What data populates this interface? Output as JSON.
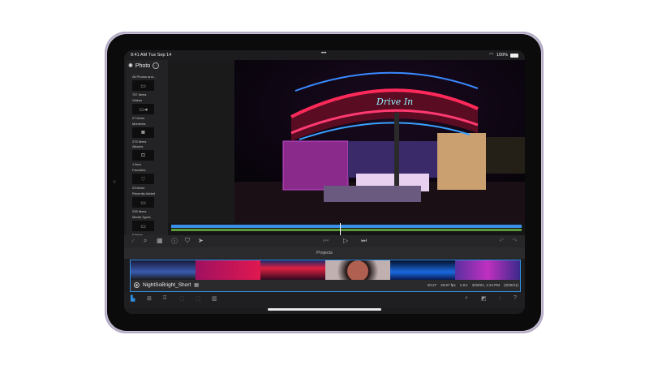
{
  "status": {
    "time": "9:41 AM",
    "date": "Tue Sep 14",
    "battery": "100%",
    "wifi_icon": "wifi-icon",
    "battery_icon": "battery-icon"
  },
  "sidebar": {
    "title": "Photo",
    "items": [
      {
        "label": "All Photos and...",
        "count": "757 items",
        "icon": "folder-icon"
      },
      {
        "label": "Videos",
        "count": "27 items",
        "icon": "video-icon"
      },
      {
        "label": "Moments",
        "count": "275 items",
        "icon": "moments-icon"
      },
      {
        "label": "Albums",
        "count": "1 item",
        "icon": "album-icon"
      },
      {
        "label": "Favorites",
        "count": "23 items",
        "icon": "heart-icon"
      },
      {
        "label": "Recently Added",
        "count": "235 items",
        "icon": "folder-icon"
      },
      {
        "label": "Media Types",
        "count": "6 items",
        "icon": "folder-icon"
      }
    ]
  },
  "viewer": {
    "sign_text": "Drive In"
  },
  "projects": {
    "label": "Projects",
    "name": "NightSoBright_Short",
    "duration": "20:27",
    "fps": "29.97 fps",
    "aspect": "1.9:1",
    "date": "3/20/21, 1:24 PM",
    "modified": "(3/20/21)"
  },
  "colors": {
    "accent": "#2f8fe0",
    "timeline_blue": "#3a8ee6",
    "timeline_green": "#5a9a3a"
  }
}
